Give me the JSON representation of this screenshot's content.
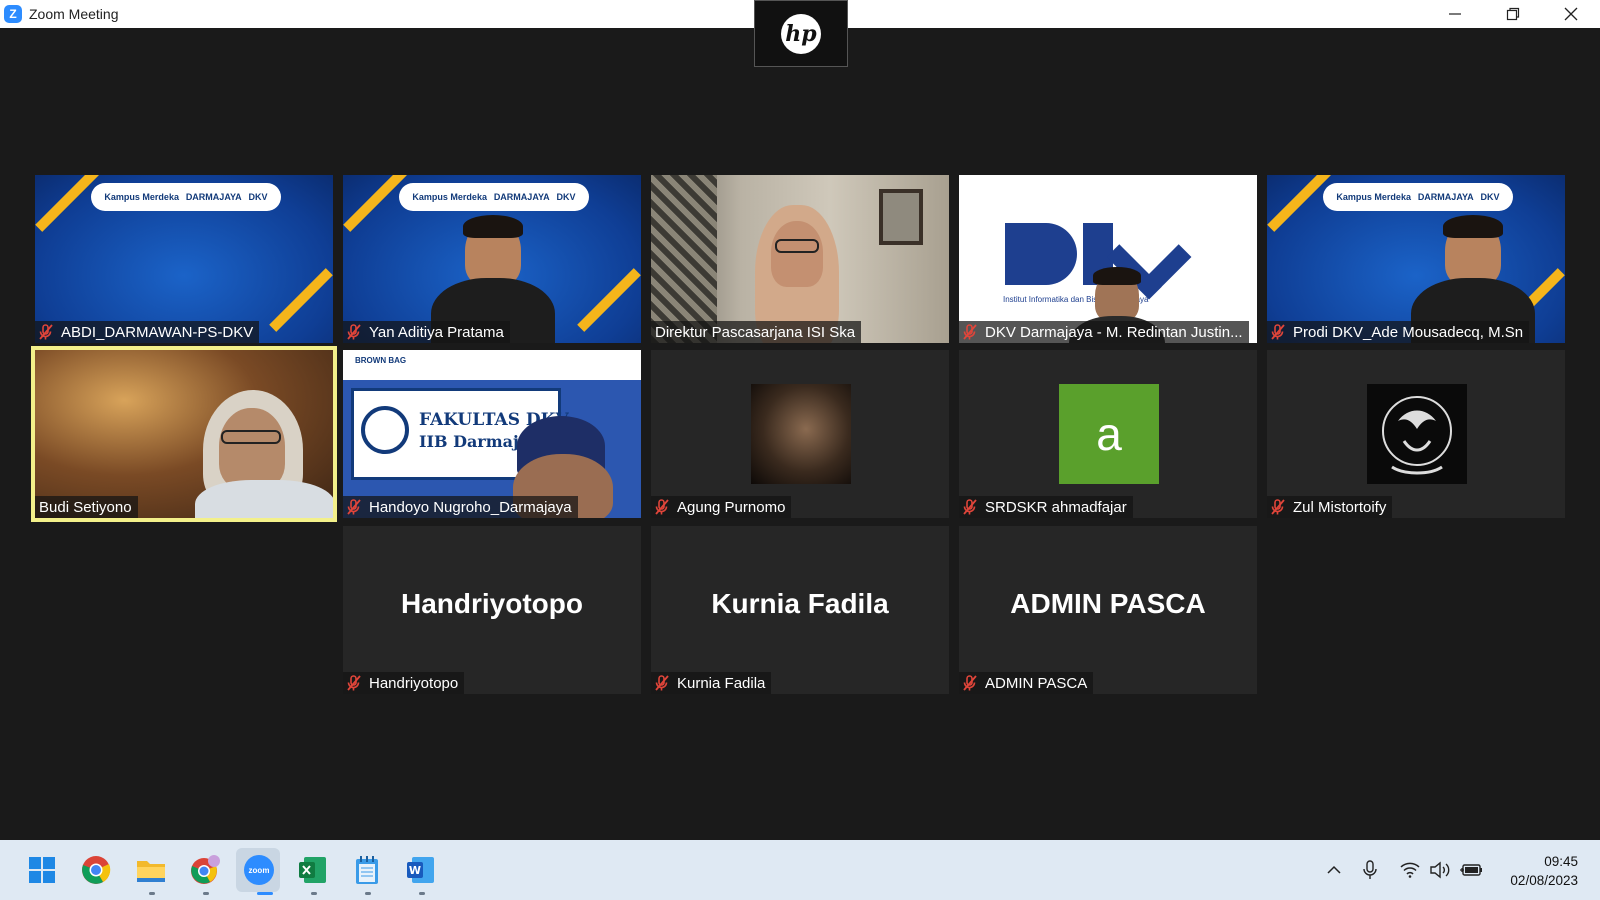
{
  "window": {
    "title": "Zoom Meeting",
    "app_logo": "Z",
    "controls": [
      "minimize-icon",
      "restore-icon",
      "close-icon"
    ]
  },
  "camera_overlay": {
    "logo_text": "hp"
  },
  "participants": [
    {
      "name": "ABDI_DARMAWAN-PS-DKV",
      "muted": true,
      "video": "banner"
    },
    {
      "name": "Yan Aditiya Pratama",
      "muted": true,
      "video": "banner-person"
    },
    {
      "name": "Direktur Pascasarjana ISI Ska",
      "muted": false,
      "video": "office-person"
    },
    {
      "name": "DKV Darmajaya - M. Redintan Justin...",
      "muted": true,
      "video": "dkv-logo"
    },
    {
      "name": "Prodi DKV_Ade Mousadecq, M.Sn",
      "muted": true,
      "video": "banner-person"
    },
    {
      "name": "Budi Setiyono",
      "muted": false,
      "video": "person",
      "active_speaker": true
    },
    {
      "name": "Handoyo Nugroho_Darmajaya",
      "muted": true,
      "video": "fakultas"
    },
    {
      "name": "Agung Purnomo",
      "muted": true,
      "video": "avatar-photo"
    },
    {
      "name": "SRDSKR ahmadfajar",
      "muted": true,
      "video": "avatar-letter",
      "avatar_letter": "a",
      "avatar_color": "#5aa02c"
    },
    {
      "name": "Zul Mistortoify",
      "muted": true,
      "video": "avatar-emblem"
    },
    {
      "name": "Handriyotopo",
      "muted": true,
      "video": "name-only",
      "display_name": "Handriyotopo"
    },
    {
      "name": "Kurnia Fadila",
      "muted": true,
      "video": "name-only",
      "display_name": "Kurnia Fadila"
    },
    {
      "name": "ADMIN  PASCA",
      "muted": true,
      "video": "name-only",
      "display_name": "ADMIN  PASCA"
    }
  ],
  "banner": {
    "left": "Kampus Merdeka",
    "middle": "DARMAJAYA",
    "right": "DKV"
  },
  "dkv_logo": {
    "sub": "Institut Informatika dan Bisnis Darmajaya"
  },
  "fakultas_slide": {
    "line1": "FAKULTAS DKV",
    "line2": "IIB Darmajaya",
    "tag": "BROWN BAG"
  },
  "taskbar": {
    "apps": [
      "windows-start-icon",
      "chrome-icon",
      "file-explorer-icon",
      "chrome-profile-icon",
      "zoom-icon",
      "excel-icon",
      "notepad-icon",
      "word-icon"
    ],
    "zoom_label": "zoom",
    "tray": [
      "chevron-up-icon",
      "microphone-icon",
      "wifi-icon",
      "volume-icon",
      "battery-icon"
    ],
    "time": "09:45",
    "date": "02/08/2023"
  },
  "colors": {
    "active_border": "#f3f08a",
    "mute_red": "#e0453a",
    "zoom_blue": "#2d8cff",
    "stage_bg": "#1a1a1a",
    "tile_bg": "#262626"
  }
}
